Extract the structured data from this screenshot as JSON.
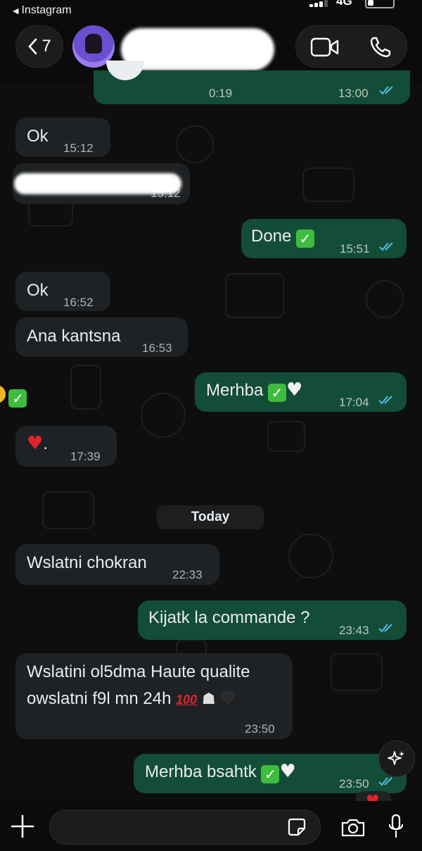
{
  "status_bar": {
    "back_app": "Instagram",
    "network": "4G"
  },
  "header": {
    "unread_count": "7"
  },
  "messages": [
    {
      "id": "m0",
      "dir": "out",
      "duration": "0:19",
      "time": "13:00",
      "ticks": "read"
    },
    {
      "id": "m1",
      "dir": "in",
      "text": "Ok",
      "time": "15:12"
    },
    {
      "id": "m2",
      "dir": "in",
      "text": "",
      "time": "15:12",
      "redacted": true
    },
    {
      "id": "m3",
      "dir": "out",
      "text": "Done",
      "emoji": "check",
      "time": "15:51",
      "ticks": "read"
    },
    {
      "id": "m4",
      "dir": "in",
      "text": "Ok",
      "time": "16:52"
    },
    {
      "id": "m5",
      "dir": "in",
      "text": "Ana kantsna",
      "time": "16:53"
    },
    {
      "id": "m6",
      "dir": "out",
      "text": "Merhba",
      "emoji": "check,white-heart",
      "time": "17:04",
      "ticks": "read"
    },
    {
      "id": "m7",
      "dir": "in",
      "text": ".",
      "emoji": "red-heart",
      "time": "17:39"
    },
    {
      "id": "m8",
      "dir": "in",
      "text": "Wslatni chokran",
      "time": "22:33"
    },
    {
      "id": "m9",
      "dir": "out",
      "text": "Kijatk la commande ?",
      "time": "23:43",
      "ticks": "read"
    },
    {
      "id": "m10",
      "dir": "in",
      "line1": "Wslatini ol5dma Haute qualite",
      "line2": "owslatni f9l mn 24h",
      "emoji": "hundred,ninja,black-heart",
      "time": "23:50"
    },
    {
      "id": "m11",
      "dir": "out",
      "text": "Merhba bsahtk",
      "emoji": "check,white-heart",
      "time": "23:50",
      "ticks": "read"
    }
  ],
  "date_divider": "Today",
  "colors": {
    "outgoing": "#134d37",
    "incoming": "#1f2224",
    "read_tick": "#53bdeb",
    "background": "#0e0e0e"
  },
  "icons": [
    "back-chevron-icon",
    "video-call-icon",
    "phone-icon",
    "plus-icon",
    "sticker-icon",
    "camera-icon",
    "microphone-icon",
    "ai-sparkle-icon",
    "read-ticks-icon"
  ]
}
